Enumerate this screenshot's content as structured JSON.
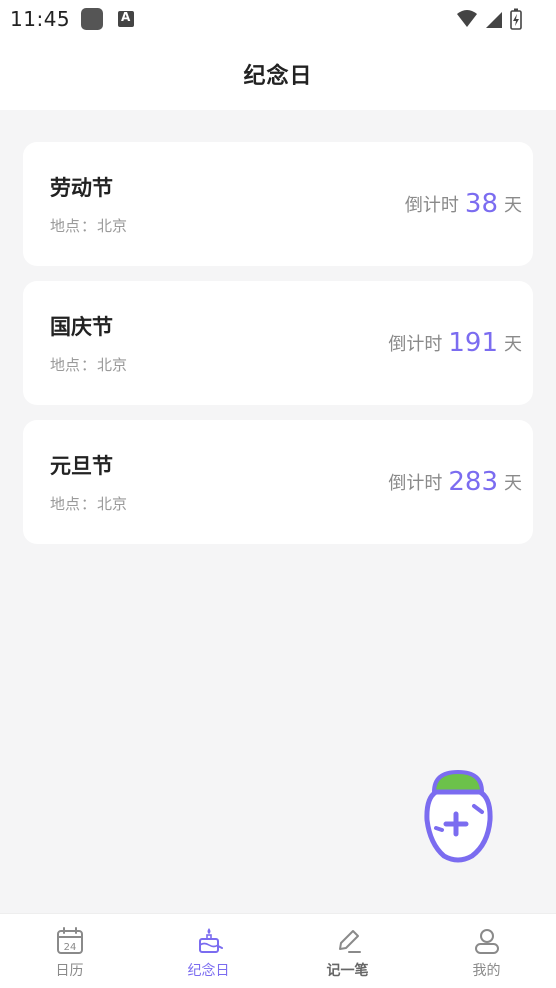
{
  "status_bar": {
    "time": "11:45",
    "icons": [
      "app-notification-icon",
      "text-a-icon",
      "wifi-icon",
      "signal-icon",
      "battery-charging-icon"
    ]
  },
  "header": {
    "title": "纪念日"
  },
  "events": [
    {
      "name": "劳动节",
      "location_label": "地点",
      "separator": "：",
      "location": "北京",
      "countdown_label": "倒计时",
      "days": "38",
      "unit": "天"
    },
    {
      "name": "国庆节",
      "location_label": "地点",
      "separator": "：",
      "location": "北京",
      "countdown_label": "倒计时",
      "days": "191",
      "unit": "天"
    },
    {
      "name": "元旦节",
      "location_label": "地点",
      "separator": "：",
      "location": "北京",
      "countdown_label": "倒计时",
      "days": "283",
      "unit": "天"
    }
  ],
  "fab": {
    "icon": "carrot-add-icon"
  },
  "tabbar": {
    "items": [
      {
        "label": "日历",
        "icon": "calendar-icon",
        "calendar_number": "24"
      },
      {
        "label": "纪念日",
        "icon": "cake-icon"
      },
      {
        "label": "记一笔",
        "icon": "pencil-icon"
      },
      {
        "label": "我的",
        "icon": "user-icon"
      }
    ],
    "active_index": 1
  },
  "colors": {
    "accent": "#7b6cf0",
    "fab_leaf": "#6cc24a",
    "background": "#f5f5f6",
    "card": "#ffffff"
  }
}
